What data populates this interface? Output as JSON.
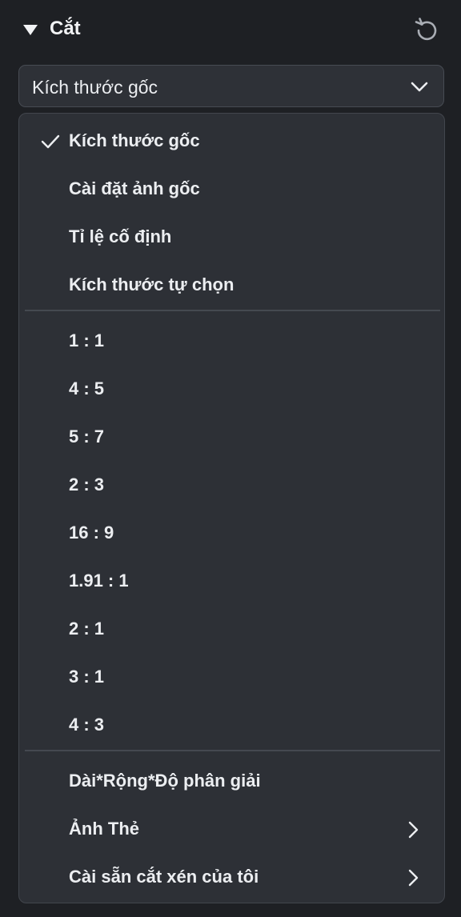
{
  "panel": {
    "title": "Cắt"
  },
  "select": {
    "value": "Kích thước gốc"
  },
  "menu": {
    "group1": [
      {
        "label": "Kích thước gốc",
        "selected": true
      },
      {
        "label": "Cài đặt ảnh gốc",
        "selected": false
      },
      {
        "label": "Tỉ lệ cố định",
        "selected": false
      },
      {
        "label": "Kích thước tự chọn",
        "selected": false
      }
    ],
    "group2": [
      {
        "label": "1 : 1"
      },
      {
        "label": "4 : 5"
      },
      {
        "label": "5 : 7"
      },
      {
        "label": "2 : 3"
      },
      {
        "label": "16 : 9"
      },
      {
        "label": "1.91 : 1"
      },
      {
        "label": "2 : 1"
      },
      {
        "label": "3 : 1"
      },
      {
        "label": "4 : 3"
      }
    ],
    "group3": [
      {
        "label": "Dài*Rộng*Độ phân giải",
        "submenu": false
      },
      {
        "label": "Ảnh Thẻ",
        "submenu": true
      },
      {
        "label": "Cài sẵn cắt xén của tôi",
        "submenu": true
      }
    ]
  },
  "icons": {
    "collapse": "triangle-down-icon",
    "reset": "reset-icon",
    "chevron": "chevron-down-icon",
    "check": "checkmark-icon",
    "submenu": "chevron-right-icon"
  },
  "colors": {
    "background": "#1e2024",
    "menu_bg": "#2d3036",
    "text": "#eceef1",
    "divider": "#454950"
  }
}
